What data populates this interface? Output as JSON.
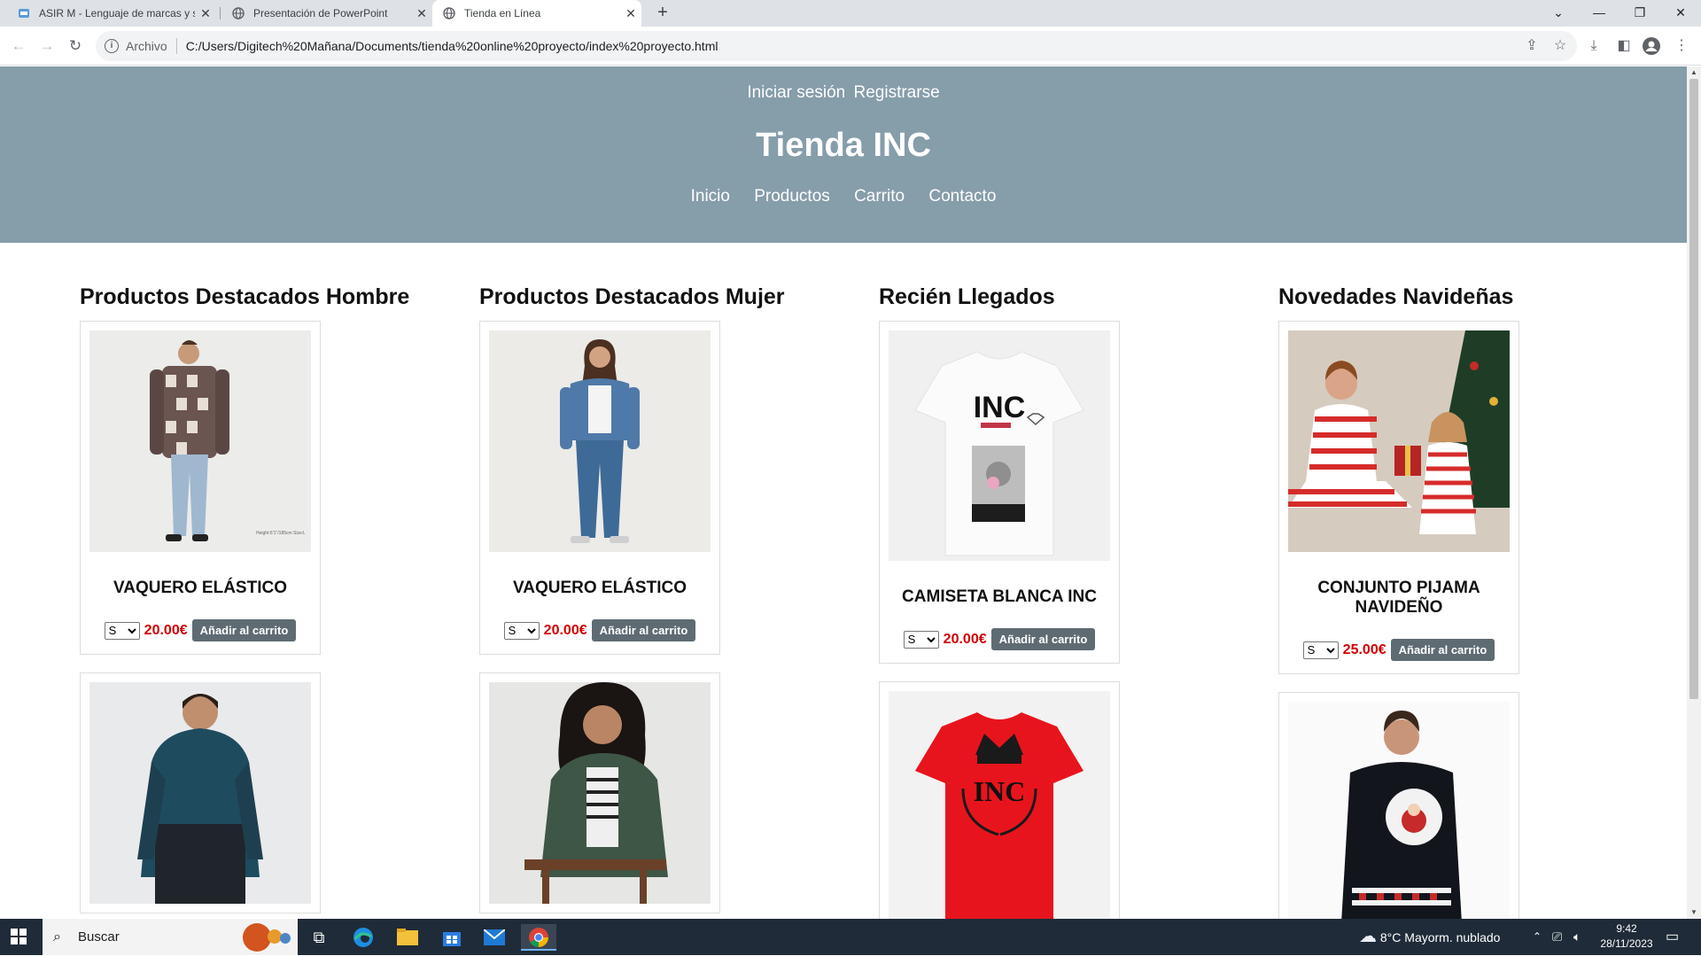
{
  "browser": {
    "tabs": [
      {
        "title": "ASIR M - Lenguaje de marcas y s"
      },
      {
        "title": "Presentación de PowerPoint"
      },
      {
        "title": "Tienda en Línea"
      }
    ],
    "address": {
      "scheme": "Archivo",
      "url": "C:/Users/Digitech%20Mañana/Documents/tienda%20online%20proyecto/index%20proyecto.html"
    }
  },
  "site": {
    "auth": {
      "login": "Iniciar sesión",
      "register": "Registrarse"
    },
    "brand": "Tienda INC",
    "nav": [
      "Inicio",
      "Productos",
      "Carrito",
      "Contacto"
    ],
    "header_color": "#869daa"
  },
  "sections": [
    {
      "title": "Productos Destacados Hombre",
      "products": [
        {
          "name": "VAQUERO ELÁSTICO",
          "size": "S",
          "price": "20.00€",
          "button": "Añadir al carrito",
          "photo_caption": "Height:6'1''/185cm Size:L"
        }
      ]
    },
    {
      "title": "Productos Destacados Mujer",
      "products": [
        {
          "name": "VAQUERO ELÁSTICO",
          "size": "S",
          "price": "20.00€",
          "button": "Añadir al carrito"
        }
      ]
    },
    {
      "title": "Recién Llegados",
      "products": [
        {
          "name": "CAMISETA BLANCA INC",
          "size": "S",
          "price": "20.00€",
          "button": "Añadir al carrito",
          "print": "INC"
        }
      ]
    },
    {
      "title": "Novedades Navideñas",
      "products": [
        {
          "name": "CONJUNTO PIJAMA NAVIDEÑO",
          "size": "S",
          "price": "25.00€",
          "button": "Añadir al carrito"
        }
      ]
    }
  ],
  "next_row": {
    "tshirt_print": "INC"
  },
  "taskbar": {
    "search_placeholder": "Buscar",
    "weather": "8°C  Mayorm. nublado",
    "time": "9:42",
    "date": "28/11/2023"
  },
  "colors": {
    "price": "#d10000",
    "button": "#5f6b73"
  }
}
